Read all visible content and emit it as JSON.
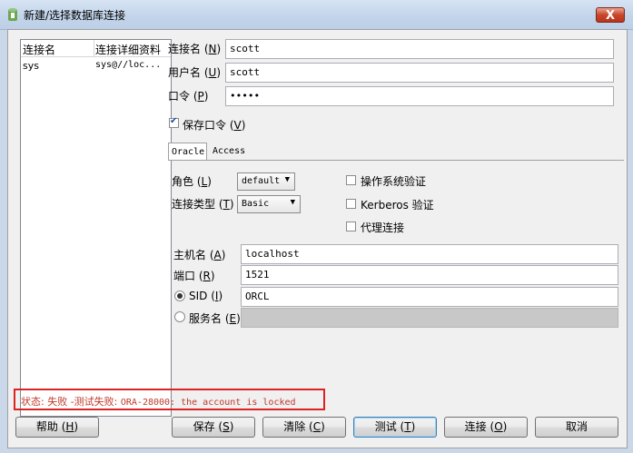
{
  "window": {
    "title": "新建/选择数据库连接",
    "close": "X"
  },
  "conn_list": {
    "headers": [
      "连接名",
      "连接详细资料"
    ],
    "rows": [
      {
        "name": "sys",
        "detail": "sys@//loc..."
      }
    ]
  },
  "form": {
    "conn_name_label": "连接名",
    "conn_name_key": "N",
    "conn_name_value": "scott",
    "user_label": "用户名",
    "user_key": "U",
    "user_value": "scott",
    "password_label": "口令",
    "password_key": "P",
    "password_value": "•••••",
    "save_password_label": "保存口令",
    "save_password_key": "V",
    "save_password_checked": true
  },
  "tabs": [
    "Oracle",
    "Access"
  ],
  "oracle": {
    "role_label": "角色",
    "role_key": "L",
    "role_value": "default",
    "conn_type_label": "连接类型",
    "conn_type_key": "T",
    "conn_type_value": "Basic",
    "os_auth_label": "操作系统验证",
    "kerberos_label": "Kerberos 验证",
    "proxy_label": "代理连接",
    "host_label": "主机名",
    "host_key": "A",
    "host_value": "localhost",
    "port_label": "端口",
    "port_key": "R",
    "port_value": "1521",
    "sid_label": "SID",
    "sid_key": "I",
    "sid_value": "ORCL",
    "service_label": "服务名",
    "service_key": "E",
    "service_value": ""
  },
  "status": {
    "prefix": "状态: 失败 -测试失败: ",
    "message": "ORA-28000: the account is locked",
    "color": "#c0392b"
  },
  "buttons": {
    "help": "帮助",
    "help_key": "H",
    "save": "保存",
    "save_key": "S",
    "clear": "清除",
    "clear_key": "C",
    "test": "测试",
    "test_key": "T",
    "connect": "连接",
    "connect_key": "O",
    "cancel": "取消"
  }
}
